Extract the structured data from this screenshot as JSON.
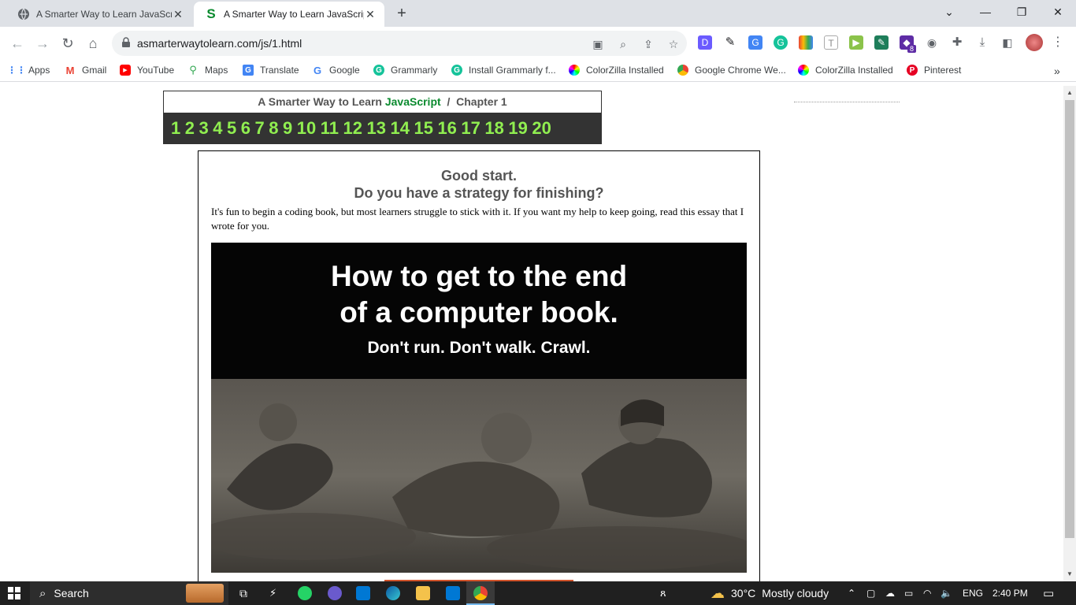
{
  "browser": {
    "tabs": [
      {
        "title": "A Smarter Way to Learn JavaScrip",
        "active": false
      },
      {
        "title": "A Smarter Way to Learn JavaScrip",
        "active": true
      }
    ],
    "new_tab": "+",
    "window_controls": {
      "chevron": "⌄",
      "minimize": "—",
      "restore": "❐",
      "close": "✕"
    },
    "url": "asmarterwaytolearn.com/js/1.html",
    "bookmarks": [
      {
        "label": "Apps",
        "icon": "apps-grid-icon"
      },
      {
        "label": "Gmail",
        "icon": "gmail-icon"
      },
      {
        "label": "YouTube",
        "icon": "youtube-icon"
      },
      {
        "label": "Maps",
        "icon": "maps-icon"
      },
      {
        "label": "Translate",
        "icon": "translate-icon"
      },
      {
        "label": "Google",
        "icon": "google-icon"
      },
      {
        "label": "Grammarly",
        "icon": "grammarly-icon"
      },
      {
        "label": "Install Grammarly f...",
        "icon": "grammarly-icon"
      },
      {
        "label": "ColorZilla Installed",
        "icon": "colorzilla-icon"
      },
      {
        "label": "Google Chrome We...",
        "icon": "chrome-icon"
      },
      {
        "label": "ColorZilla Installed",
        "icon": "colorzilla-icon"
      },
      {
        "label": "Pinterest",
        "icon": "pinterest-icon"
      }
    ],
    "bookmarks_overflow": "»",
    "extension_badge": "8"
  },
  "page": {
    "header": {
      "prefix": "A Smarter Way to Learn ",
      "language": "JavaScript",
      "separator": "  /  ",
      "chapter": "Chapter 1"
    },
    "chapters": [
      "1",
      "2",
      "3",
      "4",
      "5",
      "6",
      "7",
      "8",
      "9",
      "10",
      "11",
      "12",
      "13",
      "14",
      "15",
      "16",
      "17",
      "18",
      "19",
      "20"
    ],
    "headline_line1": "Good start.",
    "headline_line2": "Do you have a strategy for finishing?",
    "body": "It's fun to begin a coding book, but most learners struggle to stick with it. If you want my help to keep going, read this essay that I wrote for you.",
    "promo": {
      "title_line1": "How to get to the end",
      "title_line2": "of a computer book.",
      "subtitle": "Don't run. Don't walk. Crawl."
    }
  },
  "taskbar": {
    "search": "Search",
    "weather_temp": "30°C",
    "weather_desc": "Mostly cloudy",
    "language": "ENG",
    "time": "2:40 PM"
  },
  "colors": {
    "accent_green": "#0a8a2e",
    "chapter_green": "#90ee50",
    "nav_bg": "#333333",
    "orange": "#d2542b"
  }
}
